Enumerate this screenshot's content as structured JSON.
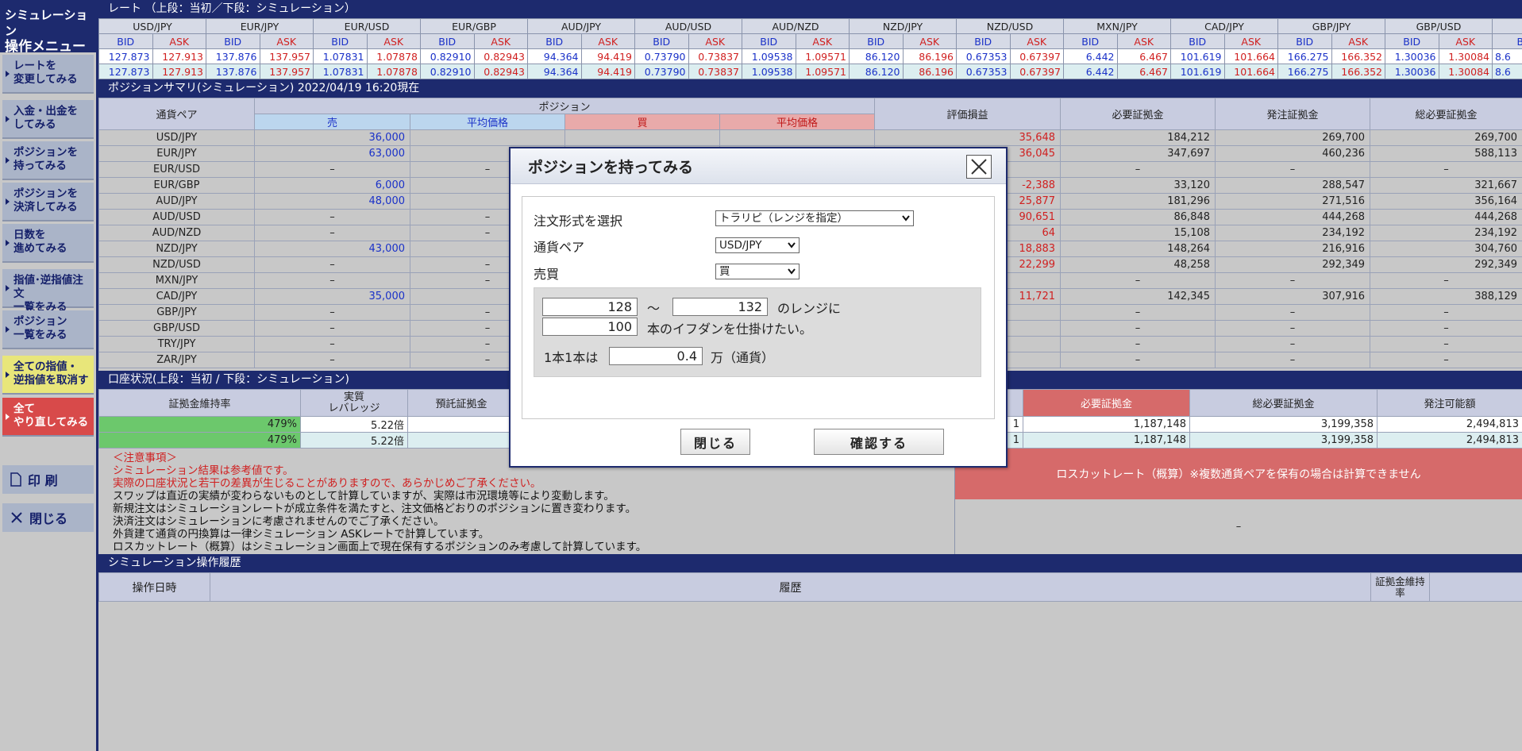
{
  "sidebar": {
    "title_line1": "シミュレーション",
    "title_line2": "操作メニュー",
    "items": [
      {
        "label": "レートを\n変更してみる"
      },
      {
        "label": "入金・出金を\nしてみる"
      },
      {
        "label": "ポジションを\n持ってみる"
      },
      {
        "label": "ポジションを\n決済してみる"
      },
      {
        "label": "日数を\n進めてみる"
      },
      {
        "label": "指値･逆指値注文\n一覧をみる"
      },
      {
        "label": "ポジション\n一覧をみる"
      },
      {
        "label": "全ての指値・\n逆指値を取消す"
      },
      {
        "label": "全て\nやり直してみる"
      }
    ],
    "print_label": "印 刷",
    "close_label": "閉じる"
  },
  "rates": {
    "title": "レート （上段：当初／下段：シミュレーション）",
    "bid_label": "BID",
    "ask_label": "ASK",
    "pairs": [
      "USD/JPY",
      "EUR/JPY",
      "EUR/USD",
      "EUR/GBP",
      "AUD/JPY",
      "AUD/USD",
      "AUD/NZD",
      "NZD/JPY",
      "NZD/USD",
      "MXN/JPY",
      "CAD/JPY",
      "GBP/JPY",
      "GBP/USD"
    ],
    "initial": [
      [
        "127.873",
        "127.913"
      ],
      [
        "137.876",
        "137.957"
      ],
      [
        "1.07831",
        "1.07878"
      ],
      [
        "0.82910",
        "0.82943"
      ],
      [
        "94.364",
        "94.419"
      ],
      [
        "0.73790",
        "0.73837"
      ],
      [
        "1.09538",
        "1.09571"
      ],
      [
        "86.120",
        "86.196"
      ],
      [
        "0.67353",
        "0.67397"
      ],
      [
        "6.442",
        "6.467"
      ],
      [
        "101.619",
        "101.664"
      ],
      [
        "166.275",
        "166.352"
      ],
      [
        "1.30036",
        "1.30084"
      ]
    ],
    "sim": [
      [
        "127.873",
        "127.913"
      ],
      [
        "137.876",
        "137.957"
      ],
      [
        "1.07831",
        "1.07878"
      ],
      [
        "0.82910",
        "0.82943"
      ],
      [
        "94.364",
        "94.419"
      ],
      [
        "0.73790",
        "0.73837"
      ],
      [
        "1.09538",
        "1.09571"
      ],
      [
        "86.120",
        "86.196"
      ],
      [
        "0.67353",
        "0.67397"
      ],
      [
        "6.442",
        "6.467"
      ],
      [
        "101.619",
        "101.664"
      ],
      [
        "166.275",
        "166.352"
      ],
      [
        "1.30036",
        "1.30084"
      ]
    ],
    "partial": "8.6"
  },
  "positions": {
    "title": "ポジションサマリ(シミュレーション) 2022/04/19 16:20現在",
    "h_pair": "通貨ペア",
    "h_position": "ポジション",
    "h_sell": "売",
    "h_avg_sell": "平均価格",
    "h_buy": "買",
    "h_avg_buy": "平均価格",
    "h_pl": "評価損益",
    "h_req": "必要証拠金",
    "h_order": "発注証拠金",
    "h_total": "総必要証拠金",
    "rows": [
      {
        "pair": "USD/JPY",
        "sell": "36,000",
        "avg": "",
        "pl": "35,648",
        "req": "184,212",
        "order": "269,700",
        "total": "269,700"
      },
      {
        "pair": "EUR/JPY",
        "sell": "63,000",
        "avg": "",
        "pl": "36,045",
        "req": "347,697",
        "order": "460,236",
        "total": "588,113"
      },
      {
        "pair": "EUR/USD",
        "sell": "–",
        "avg": "–",
        "pl": "",
        "req": "–",
        "order": "–",
        "total": "–"
      },
      {
        "pair": "EUR/GBP",
        "sell": "6,000",
        "avg": "",
        "pl": "-2,388",
        "req": "33,120",
        "order": "288,547",
        "total": "321,667"
      },
      {
        "pair": "AUD/JPY",
        "sell": "48,000",
        "avg": "",
        "pl": "25,877",
        "req": "181,296",
        "order": "271,516",
        "total": "356,164"
      },
      {
        "pair": "AUD/USD",
        "sell": "–",
        "avg": "–",
        "pl": "90,651",
        "req": "86,848",
        "order": "444,268",
        "total": "444,268"
      },
      {
        "pair": "AUD/NZD",
        "sell": "–",
        "avg": "–",
        "pl": "64",
        "req": "15,108",
        "order": "234,192",
        "total": "234,192"
      },
      {
        "pair": "NZD/JPY",
        "sell": "43,000",
        "avg": "",
        "pl": "18,883",
        "req": "148,264",
        "order": "216,916",
        "total": "304,760"
      },
      {
        "pair": "NZD/USD",
        "sell": "–",
        "avg": "–",
        "pl": "22,299",
        "req": "48,258",
        "order": "292,349",
        "total": "292,349"
      },
      {
        "pair": "MXN/JPY",
        "sell": "–",
        "avg": "–",
        "pl": "",
        "req": "–",
        "order": "–",
        "total": "–"
      },
      {
        "pair": "CAD/JPY",
        "sell": "35,000",
        "avg": "",
        "pl": "11,721",
        "req": "142,345",
        "order": "307,916",
        "total": "388,129"
      },
      {
        "pair": "GBP/JPY",
        "sell": "–",
        "avg": "–",
        "pl": "",
        "req": "–",
        "order": "–",
        "total": "–"
      },
      {
        "pair": "GBP/USD",
        "sell": "–",
        "avg": "–",
        "pl": "",
        "req": "–",
        "order": "–",
        "total": "–"
      },
      {
        "pair": "TRY/JPY",
        "sell": "–",
        "avg": "–",
        "pl": "",
        "req": "–",
        "order": "–",
        "total": "–"
      },
      {
        "pair": "ZAR/JPY",
        "sell": "–",
        "avg": "–",
        "pl": "",
        "req": "–",
        "order": "–",
        "total": "–"
      }
    ]
  },
  "account": {
    "title": "口座状況(上段：当初 / 下段：シミュレーション)",
    "h_rate": "証拠金維持率",
    "h_lev1": "実質",
    "h_lev2": "レバレッジ",
    "h_dep": "預託証拠金",
    "h_req": "必要証拠金",
    "h_total": "総必要証拠金",
    "h_avail": "発注可能額",
    "rows": [
      {
        "rate": "479%",
        "lev": "5.22倍",
        "mid": "1",
        "req": "1,187,148",
        "total": "3,199,358",
        "avail": "2,494,813"
      },
      {
        "rate": "479%",
        "lev": "5.22倍",
        "mid": "1",
        "req": "1,187,148",
        "total": "3,199,358",
        "avail": "2,494,813"
      }
    ]
  },
  "notes": {
    "lines": [
      {
        "text": "＜注意事項＞",
        "red": true
      },
      {
        "text": "シミュレーション結果は参考値です。",
        "red": true
      },
      {
        "text": "実際の口座状況と若干の差異が生じることがありますので、あらかじめご了承ください。",
        "red": true
      },
      {
        "text": "スワップは直近の実績が変わらないものとして計算していますが、実際は市況環境等により変動します。",
        "red": false
      },
      {
        "text": "新規注文はシミュレーションレートが成立条件を満たすと、注文価格どおりのポジションに置き変わります。",
        "red": false
      },
      {
        "text": "決済注文はシミュレーションに考慮されませんのでご了承ください。",
        "red": false
      },
      {
        "text": "外貨建て通貨の円換算は一律シミュレーション ASKレートで計算しています。",
        "red": false
      },
      {
        "text": "ロスカットレート（概算）はシミュレーション画面上で現在保有するポジションのみ考慮して計算しています。",
        "red": false
      }
    ],
    "losscut": "ロスカットレート（概算）※複数通貨ペアを保有の場合は計算できません",
    "losscut_value": "–"
  },
  "history": {
    "title": "シミュレーション操作履歴",
    "h_date": "操作日時",
    "h_hist": "履歴",
    "h_rate": "証拠金維持率"
  },
  "dialog": {
    "title": "ポジションを持ってみる",
    "order_type_label": "注文形式を選択",
    "order_type_value": "トラリピ（レンジを指定）",
    "pair_label": "通貨ペア",
    "pair_value": "USD/JPY",
    "side_label": "売買",
    "side_value": "買",
    "range_low": "128",
    "tilde": "～",
    "range_high": "132",
    "range_suffix": "のレンジに",
    "count": "100",
    "count_suffix": "本のイフダンを仕掛けたい。",
    "unit_prefix": "1本1本は",
    "unit": "0.4",
    "unit_suffix": "万（通貨）",
    "close_label": "閉じる",
    "confirm_label": "確認する"
  },
  "colors": {
    "navy": "#1d2a6e",
    "bid": "#1a31c8",
    "ask": "#d02020"
  }
}
